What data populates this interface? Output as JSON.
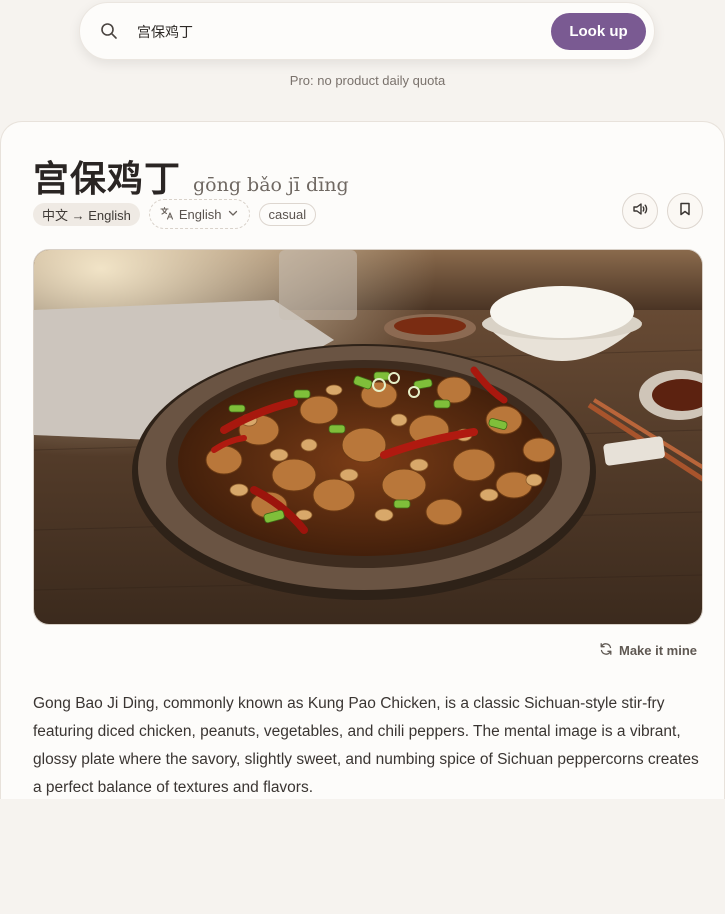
{
  "search": {
    "value": "宫保鸡丁",
    "button_label": "Look up"
  },
  "quota_note": "Pro: no product daily quota",
  "entry": {
    "hanzi": "宫保鸡丁",
    "pinyin": "gōng bǎo jī dīng",
    "tags": {
      "direction": "中文 → English",
      "language": "English",
      "register": "casual"
    },
    "make_mine_label": "Make it mine",
    "description": "Gong Bao Ji Ding, commonly known as Kung Pao Chicken, is a classic Sichuan-style stir-fry featuring diced chicken, peanuts, vegetables, and chili peppers. The mental image is a vibrant, glossy plate where the savory, slightly sweet, and numbing spice of Sichuan peppercorns creates a perfect balance of textures and flavors."
  },
  "icons": [
    "search-icon",
    "speaker-icon",
    "bookmark-icon",
    "translate-icon",
    "chevron-down-icon",
    "refresh-icon"
  ],
  "colors": {
    "accent": "#7a5a92",
    "background": "#f6f3ef",
    "card": "#fdfcfa"
  }
}
